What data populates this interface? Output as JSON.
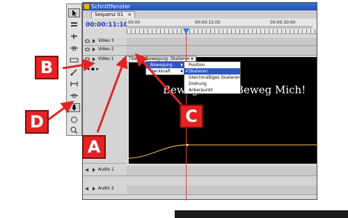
{
  "window": {
    "title": "Schnittfenster",
    "tab_label": "Sequenz 01",
    "tab_close": "×",
    "timecode": "00:00:11:10"
  },
  "ruler": {
    "labels": [
      "00:00",
      "00:00:15:00",
      "00:00:30:00"
    ]
  },
  "tracks": {
    "video3": "Video 3",
    "video2": "Video 2",
    "video1": "Video 1",
    "audio1": "Audio 1",
    "audio2": "Audio 2"
  },
  "clip": {
    "label": "Titel 01 Bewegung: Skalieren ▾"
  },
  "video": {
    "text": "Beweg Mich!    Beweg Mich!"
  },
  "menu_main": {
    "items": [
      "Bewegung",
      "Deckkraft"
    ]
  },
  "menu_sub": {
    "items": [
      "Position",
      "Skalieren",
      "Gleichmäßiges Skalieren",
      "Drehung",
      "Ankerpunkt"
    ],
    "checked_index": 1
  },
  "callouts": {
    "a": "A",
    "b": "B",
    "c": "C",
    "d": "D"
  },
  "colors": {
    "accent": "#2c59c6",
    "callout": "#e52222",
    "playhead": "#e63b3b",
    "keyframe_curve": "#d8a64a"
  },
  "icons": [
    "select-icon",
    "track-select-icon",
    "ripple-edit-icon",
    "rolling-edit-icon",
    "rate-stretch-icon",
    "razor-icon",
    "slip-icon",
    "slide-icon",
    "pen-icon",
    "hand-icon",
    "zoom-icon"
  ]
}
